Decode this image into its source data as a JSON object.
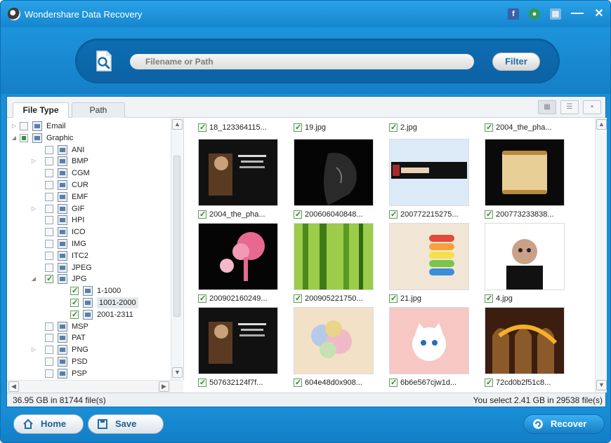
{
  "window": {
    "title": "Wondershare Data Recovery"
  },
  "titlebar_buttons": [
    "facebook-icon",
    "gift-icon",
    "feedback-icon",
    "minimize-icon",
    "close-icon"
  ],
  "search": {
    "placeholder": "Filename or Path",
    "filter_label": "Filter"
  },
  "tabs": [
    {
      "label": "File Type",
      "active": true
    },
    {
      "label": "Path",
      "active": false
    }
  ],
  "tree": [
    {
      "label": "Email",
      "level": 0,
      "expander": "▷",
      "state": "unchecked"
    },
    {
      "label": "Graphic",
      "level": 0,
      "expander": "◢",
      "state": "partial"
    },
    {
      "label": "ANI",
      "level": 1,
      "expander": "",
      "state": "unchecked"
    },
    {
      "label": "BMP",
      "level": 1,
      "expander": "▷",
      "state": "unchecked"
    },
    {
      "label": "CGM",
      "level": 1,
      "expander": "",
      "state": "unchecked"
    },
    {
      "label": "CUR",
      "level": 1,
      "expander": "",
      "state": "unchecked"
    },
    {
      "label": "EMF",
      "level": 1,
      "expander": "",
      "state": "unchecked"
    },
    {
      "label": "GIF",
      "level": 1,
      "expander": "▷",
      "state": "unchecked"
    },
    {
      "label": "HPI",
      "level": 1,
      "expander": "",
      "state": "unchecked"
    },
    {
      "label": "ICO",
      "level": 1,
      "expander": "",
      "state": "unchecked"
    },
    {
      "label": "IMG",
      "level": 1,
      "expander": "",
      "state": "unchecked"
    },
    {
      "label": "ITC2",
      "level": 1,
      "expander": "",
      "state": "unchecked"
    },
    {
      "label": "JPEG",
      "level": 1,
      "expander": "",
      "state": "unchecked"
    },
    {
      "label": "JPG",
      "level": 1,
      "expander": "◢",
      "state": "checked"
    },
    {
      "label": "1-1000",
      "level": 2,
      "expander": "",
      "state": "checked"
    },
    {
      "label": "1001-2000",
      "level": 2,
      "expander": "",
      "state": "checked",
      "selected": true
    },
    {
      "label": "2001-2311",
      "level": 2,
      "expander": "",
      "state": "checked"
    },
    {
      "label": "MSP",
      "level": 1,
      "expander": "",
      "state": "unchecked"
    },
    {
      "label": "PAT",
      "level": 1,
      "expander": "",
      "state": "unchecked"
    },
    {
      "label": "PNG",
      "level": 1,
      "expander": "▷",
      "state": "unchecked"
    },
    {
      "label": "PSD",
      "level": 1,
      "expander": "",
      "state": "unchecked"
    },
    {
      "label": "PSP",
      "level": 1,
      "expander": "",
      "state": "unchecked"
    }
  ],
  "thumbnails": [
    {
      "caption": "18_123364115...",
      "image": ""
    },
    {
      "caption": "19.jpg",
      "image": ""
    },
    {
      "caption": "2.jpg",
      "image": ""
    },
    {
      "caption": "2004_the_pha...",
      "image": ""
    },
    {
      "caption": "2004_the_pha...",
      "image": "dark-poster"
    },
    {
      "caption": "200606040848...",
      "image": "profile-silhouette"
    },
    {
      "caption": "200772215275...",
      "image": "banner-strip"
    },
    {
      "caption": "200773233838...",
      "image": "parchment"
    },
    {
      "caption": "200902160249...",
      "image": "pink-tree"
    },
    {
      "caption": "200905221750...",
      "image": "bamboo"
    },
    {
      "caption": "21.jpg",
      "image": "color-stack"
    },
    {
      "caption": "4.jpg",
      "image": "portrait"
    },
    {
      "caption": "507632124f7f...",
      "image": "dark-poster"
    },
    {
      "caption": "604e48d0x908...",
      "image": "flowers"
    },
    {
      "caption": "6b6e567cjw1d...",
      "image": "pink-cat"
    },
    {
      "caption": "72cd0b2f51c8...",
      "image": "archway"
    }
  ],
  "status": {
    "left": "36.95 GB in 81744 file(s)",
    "right": "You select 2.41 GB in 29538 file(s)"
  },
  "buttons": {
    "home": "Home",
    "save": "Save",
    "recover": "Recover"
  },
  "colors": {
    "accent": "#1b8fd6",
    "check": "#2d8a2d"
  }
}
